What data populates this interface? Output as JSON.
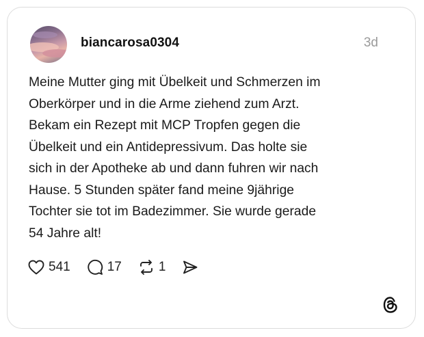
{
  "post": {
    "username": "biancarosa0304",
    "timestamp": "3d",
    "text_lines": [
      "Meine Mutter ging mit Übelkeit und Schmerzen im",
      "Oberkörper und in die Arme ziehend zum Arzt.",
      "Bekam ein Rezept mit MCP Tropfen gegen die",
      "Übelkeit und ein Antidepressivum. Das holte sie",
      "sich in der Apotheke ab und dann fuhren wir nach",
      "Hause. 5 Stunden später fand meine 9jährige",
      "Tochter sie tot im Badezimmer. Sie wurde gerade",
      "54 Jahre alt!"
    ]
  },
  "actions": {
    "like": {
      "icon": "heart-icon",
      "count": "541"
    },
    "reply": {
      "icon": "comment-icon",
      "count": "17"
    },
    "repost": {
      "icon": "repost-icon",
      "count": "1"
    },
    "share": {
      "icon": "send-icon"
    }
  },
  "branding": {
    "logo": "threads-logo-icon"
  },
  "colors": {
    "text": "#1a1a1a",
    "muted": "#9a9a9a",
    "border": "#dcdcdc"
  }
}
